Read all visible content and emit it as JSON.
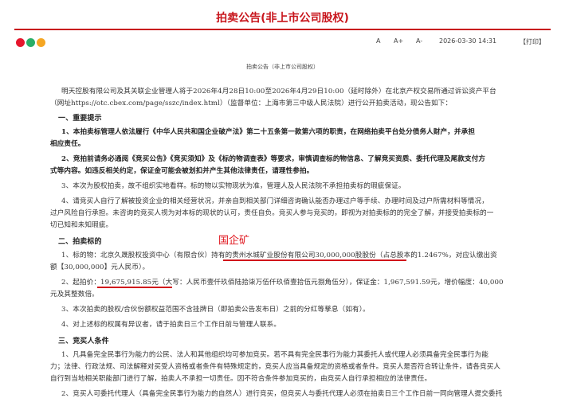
{
  "header": {
    "title": "拍卖公告(非上市公司股权)",
    "font_small": "A",
    "font_large": "A+",
    "font_reset": "A-",
    "date": "2026-03-30 14:31",
    "print": "【打印】",
    "share_colors": [
      "#e6162d",
      "#2aae67",
      "#f5a623"
    ]
  },
  "doc": {
    "subtitle": "拍卖公告（非上市公司股权）",
    "intro": [
      "明天控股有限公司及其关联企业管理人将于2026年4月28日10:00至2026年4月29日10:00（延时除外）在北京产权交易所通过诉讼资产平台",
      "（网址https://otc.cbex.com/page/sszc/index.html）（监督单位：上海市第三中级人民法院）进行公开拍卖活动，现公告如下："
    ],
    "s1": "一、重要提示",
    "p1": [
      "1、本拍卖标管理人依法履行《中华人民共和国企业破产法》第二十五条第一款第六项的职责，在网络拍卖平台处分债务人财产，并承担",
      "相应责任。"
    ],
    "p2": [
      "2、竞拍前请务必通阅《竞买公告》《竞买须知》及《标的物调查表》等要求，审慎调查标的物信息、了解竞买资质、委托代理及尾款支付方",
      "式等内容。如违反相关约定，保证金可能会被划扣并产生其他法律责任，请理性参拍。"
    ],
    "p3": "3、本次为股权拍卖，故不组织实地看样。标的物以实物现状为准，管理人及人民法院不承担拍卖标的瑕疵保证。",
    "p4": [
      "4、请竞买人自行了解被投资企业的相关经营状况，并亲自到相关部门详细咨询确认能否办理过户等手续、办理时间及过户所需材料等情况，",
      "过户风险自行承担。未咨询的竞买人视为对本标的现状的认可，责任自负。竞买人参与竞买的，即视为对拍卖标的的完全了解，并接受拍卖标的一",
      "切已知和未知瑕疵。"
    ],
    "s2": "二、拍卖标的",
    "annotation": "国企矿",
    "t1": [
      "1、标的物：北京久晟股权投资中心（有限合伙）持有的贵州水城矿业股份有限公司30,000,000股股份（占总股本的1.2467%，对应认缴出资",
      "额【30,000,000】元人民币）。"
    ],
    "t2": [
      "2、起拍价：19,675,915.85元（大写：人民币壹仟玖佰陆拾柒万伍仟玖佰壹拾伍元捌角伍分），保证金：1,967,591.59元，增价幅度：40,000",
      "元及其整数倍。"
    ],
    "t3": "3、本次拍卖的股权/合伙份额权益范围不含挂牌日（即拍卖公告发布日）之前的分红等孳息（如有）。",
    "t4": "4、对上述标的权属有异议者，请于拍卖日三个工作日前与管理人联系。",
    "s3": "三、竞买人条件",
    "c1": [
      "1、凡具备完全民事行为能力的公民、法人和其他组织均可参加竞买。若不具有完全民事行为能力其委托人或代理人必须具备完全民事行为能",
      "力；法律、行政法规、司法解释对买受人资格或者条件有特殊规定的，竞买人应当具备规定的资格或者条件。竞买人是否符合转让条件，请各竞买人",
      "自行到当地相关职能部门进行了解，拍卖人不承担一切责任。因不符合条件参加竞买的，由竞买人自行承担相应的法律责任。"
    ],
    "c2": "2、竞买人可委托代理人（具备完全民事行为能力的自然人）进行竞买，但竞买人与委托代理人必须在拍卖日三个工作日前一同向管理人提交委托"
  }
}
